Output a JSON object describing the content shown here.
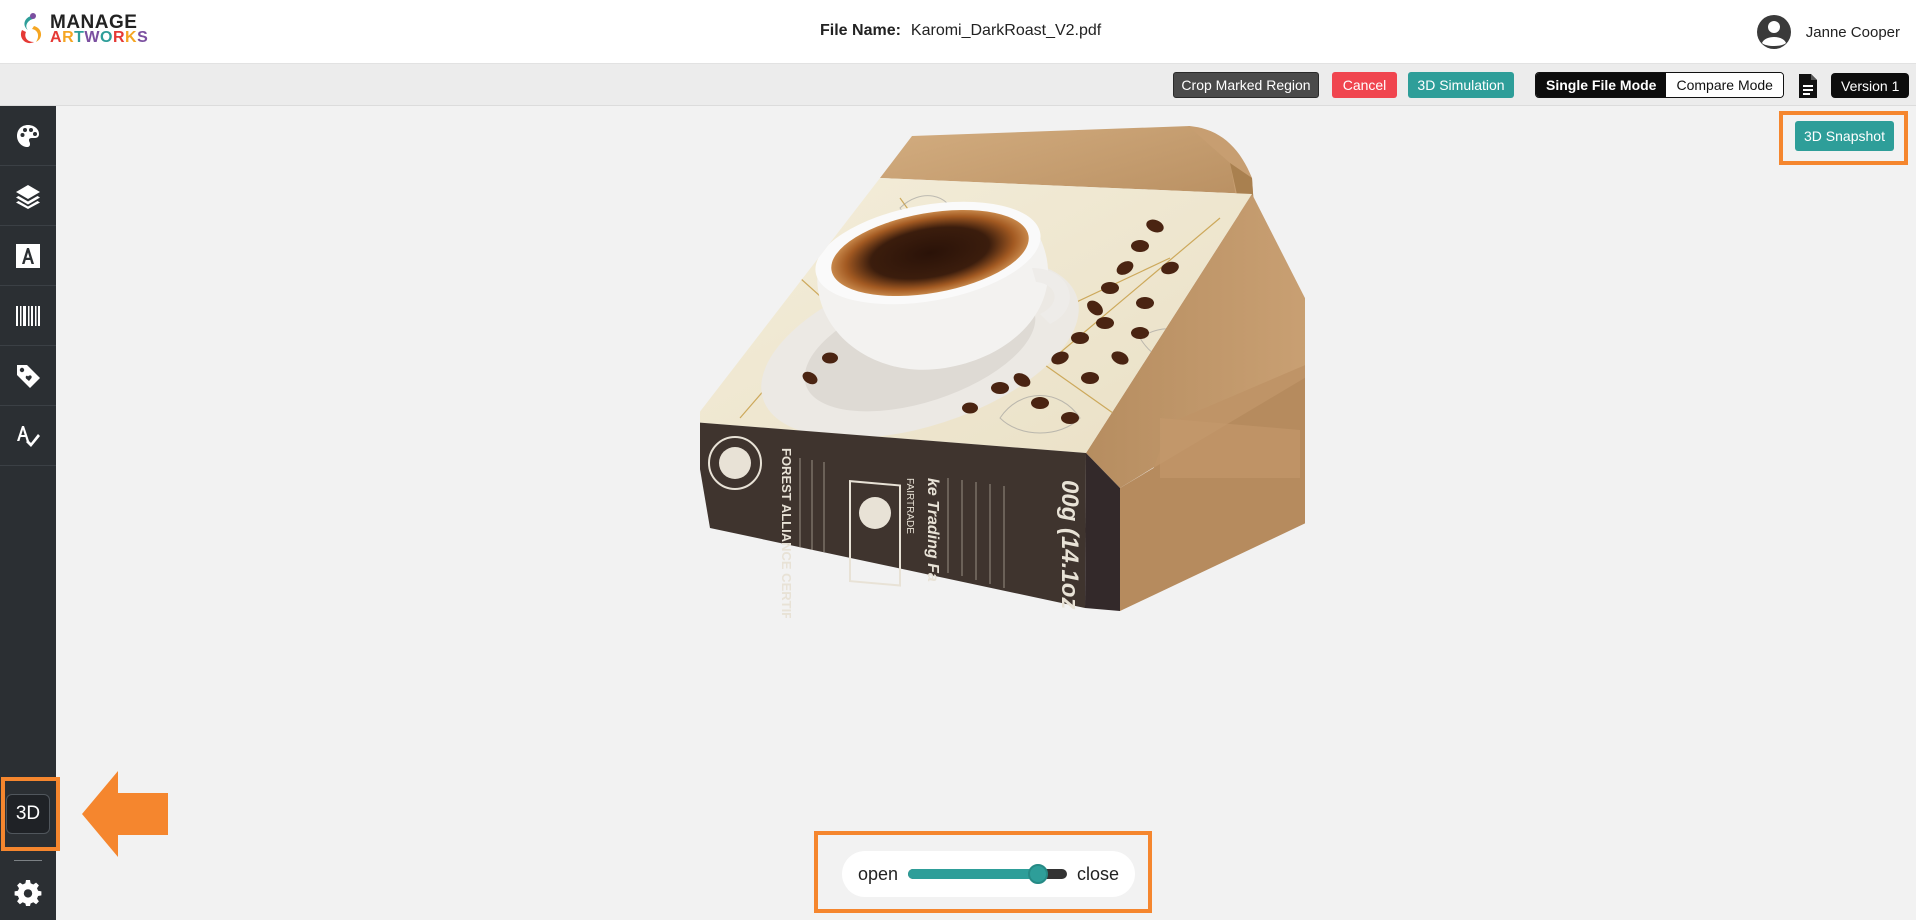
{
  "brand": {
    "line1": "MANAGE",
    "line2": "ARTWORKS"
  },
  "file": {
    "label": "File Name:",
    "value": "Karomi_DarkRoast_V2.pdf"
  },
  "user": {
    "name": "Janne Cooper",
    "icon": "user-circle-icon"
  },
  "toolbar": {
    "crop_label": "Crop Marked Region",
    "cancel_label": "Cancel",
    "simulation_label": "3D Simulation",
    "single_mode_label": "Single File Mode",
    "compare_mode_label": "Compare Mode",
    "version_label": "Version 1",
    "document_icon": "document-icon"
  },
  "sidebar": {
    "items": [
      {
        "icon": "palette-icon"
      },
      {
        "icon": "layers-icon"
      },
      {
        "icon": "text-icon"
      },
      {
        "icon": "barcode-icon"
      },
      {
        "icon": "tag-icon"
      },
      {
        "icon": "spellcheck-icon"
      }
    ],
    "mode_3d_label": "3D",
    "settings_icon": "gear-icon"
  },
  "viewer": {
    "snapshot_label": "3D Snapshot",
    "slider": {
      "left_label": "open",
      "right_label": "close",
      "value": 0.86
    },
    "package_text": {
      "certification": "FOREST ALLIANCE CERTIFICATION",
      "fairtrade": "FAIRTRADE",
      "trading": "ke Trading Fa",
      "weight": "00g (14.1oz"
    }
  },
  "colors": {
    "accent": "#2e9e99",
    "cancel": "#f0454f",
    "highlight": "#f5862e",
    "sidebar": "#2b2f33",
    "kraft": "#c29a6c"
  }
}
